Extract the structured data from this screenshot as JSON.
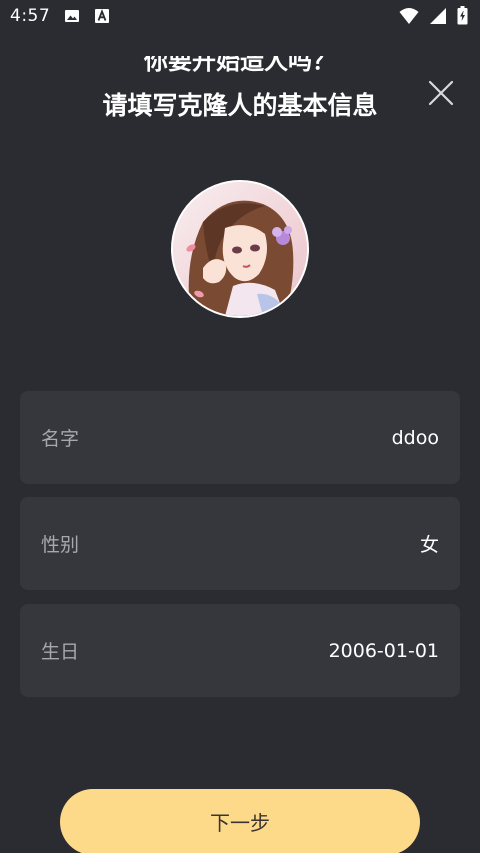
{
  "status_bar": {
    "time": "4:57",
    "icons": [
      "image-icon",
      "text-a-icon",
      "wifi-icon",
      "signal-icon",
      "battery-icon"
    ]
  },
  "header": {
    "title_top": "你要开始造人吗？",
    "title_main": "请填写克隆人的基本信息",
    "close_icon": "close-icon"
  },
  "avatar": {
    "alt": "avatar"
  },
  "fields": [
    {
      "label": "名字",
      "value": "ddoo"
    },
    {
      "label": "性别",
      "value": "女"
    },
    {
      "label": "生日",
      "value": "2006-01-01"
    }
  ],
  "next_button": {
    "label": "下一步"
  },
  "colors": {
    "background": "#2b2c31",
    "card": "#36373d",
    "accent": "#fdd98a",
    "label": "#a7a8ad"
  }
}
